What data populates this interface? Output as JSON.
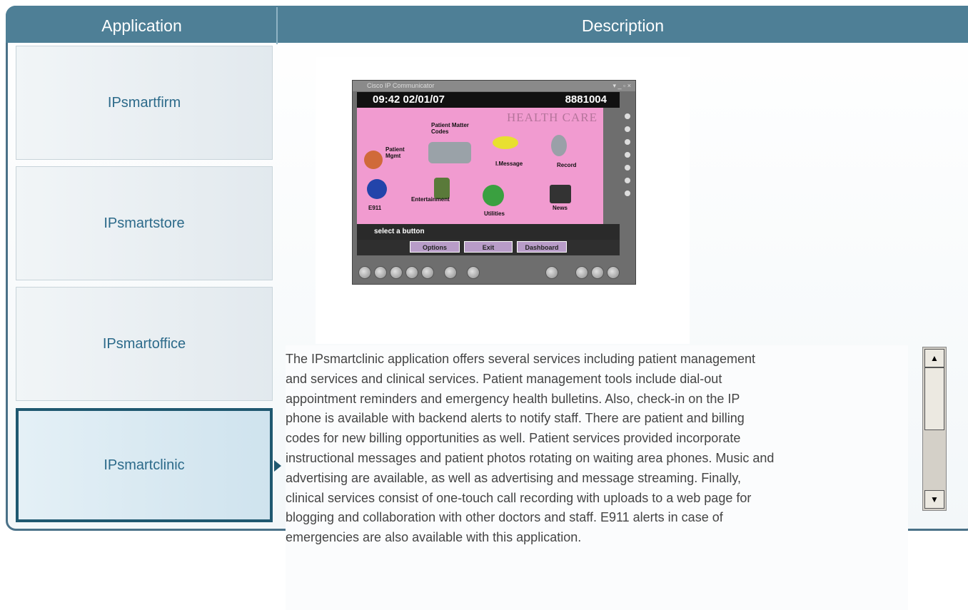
{
  "header": {
    "application": "Application",
    "description": "Description"
  },
  "apps": [
    {
      "label": "IPsmartfirm",
      "active": false
    },
    {
      "label": "IPsmartstore",
      "active": false
    },
    {
      "label": "IPsmartoffice",
      "active": false
    },
    {
      "label": "IPsmartclinic",
      "active": true
    }
  ],
  "phone": {
    "window_title": "Cisco IP Communicator",
    "time_date": "09:42 02/01/07",
    "extension": "8881004",
    "screen_title": "HEALTH CARE",
    "icons": [
      "Patient Matter Codes",
      "Patient Mgmt",
      "I.Message",
      "Record",
      "E911",
      "Entertainment",
      "Utilities",
      "News"
    ],
    "prompt": "select a button",
    "softkeys": [
      "Options",
      "Exit",
      "Dashboard"
    ]
  },
  "description_lines": [
    "The IPsmartclinic application offers several services including patient management",
    "and services and clinical services. Patient management tools include dial-out",
    "appointment reminders and emergency health bulletins. Also, check-in on the IP",
    "phone is available with backend alerts to notify staff. There are patient and billing",
    "codes for new billing opportunities as well. Patient services provided incorporate",
    "instructional messages and patient photos rotating on waiting area phones. Music and",
    "advertising are available, as well as advertising and message streaming. Finally,",
    "clinical services consist of one-touch call recording with uploads to a web page for",
    "blogging and collaboration with other doctors and staff. E911 alerts in case of",
    "emergencies are also available with this application."
  ],
  "colors": {
    "header": "#4e7f96",
    "active_border": "#1f5870",
    "app_text": "#2c6a8a"
  }
}
